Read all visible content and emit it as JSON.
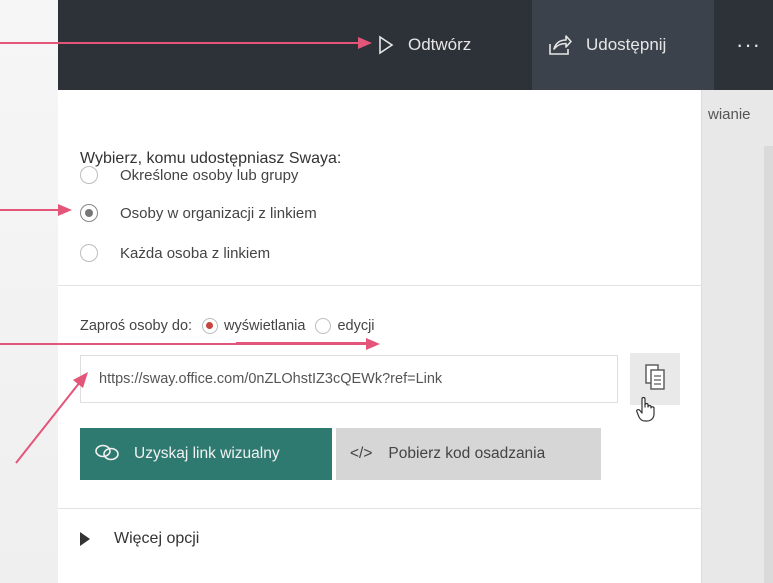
{
  "toolbar": {
    "play_label": "Odtwórz",
    "share_label": "Udostępnij",
    "more_label": "···"
  },
  "right_tab": {
    "label": "wianie"
  },
  "share_panel": {
    "heading": "Wybierz, komu udostępniasz Swaya:",
    "audience_options": [
      {
        "label": "Określone osoby lub grupy",
        "selected": false
      },
      {
        "label": "Osoby w organizacji z linkiem",
        "selected": true
      },
      {
        "label": "Każda osoba z linkiem",
        "selected": false
      }
    ],
    "invite_label": "Zaproś osoby do:",
    "permission_options": [
      {
        "label": "wyświetlania",
        "selected": true
      },
      {
        "label": "edycji",
        "selected": false
      }
    ],
    "link_url": "https://sway.office.com/0nZLOhstIZ3cQEWk?ref=Link",
    "visual_link_button": "Uzyskaj link wizualny",
    "embed_code_button": "Pobierz kod osadzania",
    "embed_code_glyph": "</>",
    "more_options_label": "Więcej opcji"
  },
  "colors": {
    "topbar": "#2d3138",
    "accent_green": "#2f7a70",
    "annotation_arrow": "#e4557a"
  },
  "icons": [
    "play-icon",
    "share-icon",
    "more-icon",
    "copy-icon",
    "hand-cursor-icon",
    "link-icon",
    "code-icon",
    "expand-triangle-icon"
  ]
}
